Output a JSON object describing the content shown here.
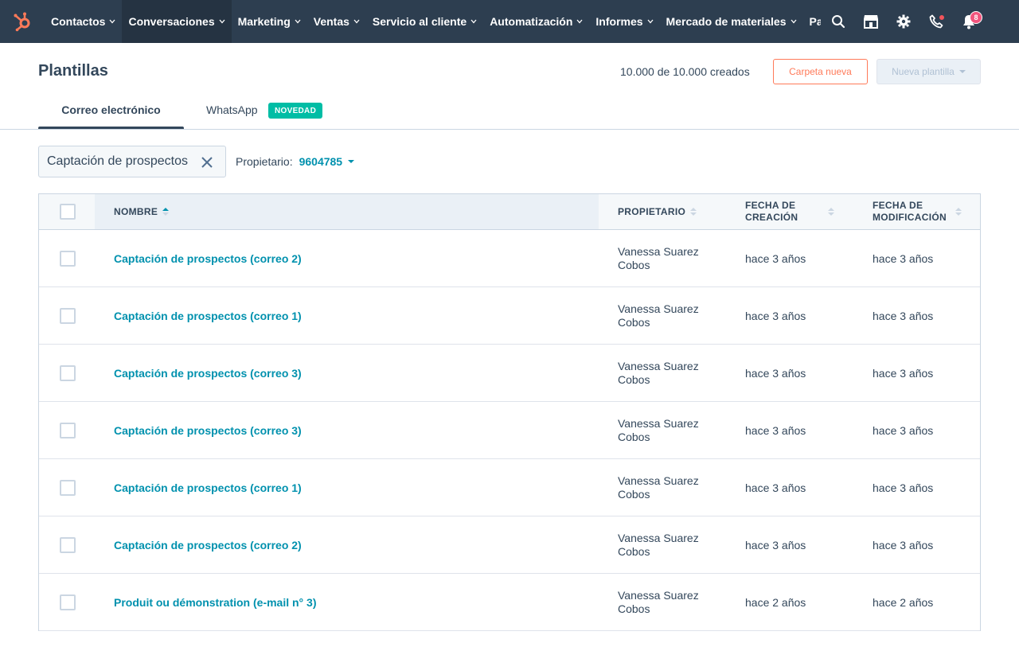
{
  "nav": {
    "items": [
      {
        "label": "Contactos",
        "active": false
      },
      {
        "label": "Conversaciones",
        "active": true
      },
      {
        "label": "Marketing",
        "active": false
      },
      {
        "label": "Ventas",
        "active": false
      },
      {
        "label": "Servicio al cliente",
        "active": false
      },
      {
        "label": "Automatización",
        "active": false
      },
      {
        "label": "Informes",
        "active": false
      },
      {
        "label": "Mercado de materiales",
        "active": false
      },
      {
        "label": "Part",
        "active": false
      }
    ],
    "notification_count": "8",
    "icons": [
      "hubspot-logo-icon",
      "search-icon",
      "marketplace-icon",
      "gear-icon",
      "phone-icon",
      "bell-icon"
    ]
  },
  "header": {
    "title": "Plantillas",
    "created_count": "10.000 de 10.000 creados",
    "new_folder_label": "Carpeta nueva",
    "new_template_label": "Nueva plantilla"
  },
  "tabs": {
    "email_label": "Correo electrónico",
    "whatsapp_label": "WhatsApp",
    "new_badge": "NOVEDAD"
  },
  "filters": {
    "search_value": "Captación de prospectos",
    "owner_label": "Propietario:",
    "owner_value": "9604785"
  },
  "table": {
    "columns": {
      "name": "NOMBRE",
      "owner": "PROPIETARIO",
      "created_line1": "FECHA DE",
      "created_line2": "CREACIÓN",
      "modified_line1": "FECHA DE",
      "modified_line2": "MODIFICACIÓN"
    },
    "rows": [
      {
        "name": "Captación de prospectos (correo 2)",
        "owner_line1": "Vanessa Suarez",
        "owner_line2": "Cobos",
        "created": "hace 3 años",
        "modified": "hace 3 años"
      },
      {
        "name": "Captación de prospectos (correo 1)",
        "owner_line1": "Vanessa Suarez",
        "owner_line2": "Cobos",
        "created": "hace 3 años",
        "modified": "hace 3 años"
      },
      {
        "name": "Captación de prospectos (correo 3)",
        "owner_line1": "Vanessa Suarez",
        "owner_line2": "Cobos",
        "created": "hace 3 años",
        "modified": "hace 3 años"
      },
      {
        "name": "Captación de prospectos (correo 3)",
        "owner_line1": "Vanessa Suarez",
        "owner_line2": "Cobos",
        "created": "hace 3 años",
        "modified": "hace 3 años"
      },
      {
        "name": "Captación de prospectos (correo 1)",
        "owner_line1": "Vanessa Suarez",
        "owner_line2": "Cobos",
        "created": "hace 3 años",
        "modified": "hace 3 años"
      },
      {
        "name": "Captación de prospectos (correo 2)",
        "owner_line1": "Vanessa Suarez",
        "owner_line2": "Cobos",
        "created": "hace 3 años",
        "modified": "hace 3 años"
      },
      {
        "name": "Produit ou démonstration (e-mail n° 3)",
        "owner_line1": "Vanessa Suarez",
        "owner_line2": "Cobos",
        "created": "hace 2 años",
        "modified": "hace 2 años"
      }
    ]
  },
  "colors": {
    "nav_bg": "#2d3e50",
    "link": "#0091ae",
    "accent_orange": "#ff7a59",
    "badge_teal": "#00bda5"
  }
}
